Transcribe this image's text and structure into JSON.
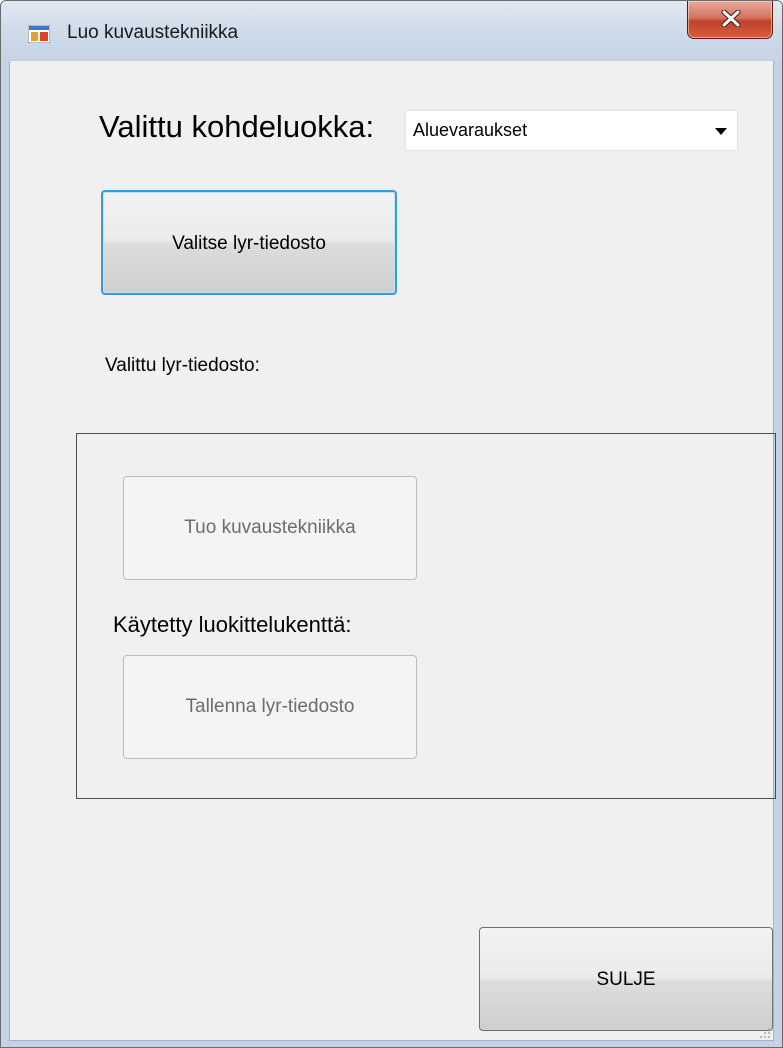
{
  "window": {
    "title": "Luo kuvaustekniikka",
    "app_icon": "form-icon",
    "close_icon": "close-icon",
    "close_color": "#c7452e"
  },
  "form": {
    "kohdeluokka_label": "Valittu kohdeluokka:",
    "kohdeluokka_value": "Aluevaraukset",
    "select_lyr_button": "Valitse lyr-tiedosto",
    "selected_lyr_label": "Valittu lyr-tiedosto:",
    "group": {
      "import_button": "Tuo kuvaustekniikka",
      "classification_field_label": "Käytetty luokittelukenttä:",
      "save_button": "Tallenna lyr-tiedosto"
    },
    "close_button": "SULJE",
    "accent_color": "#3c9ad7"
  }
}
